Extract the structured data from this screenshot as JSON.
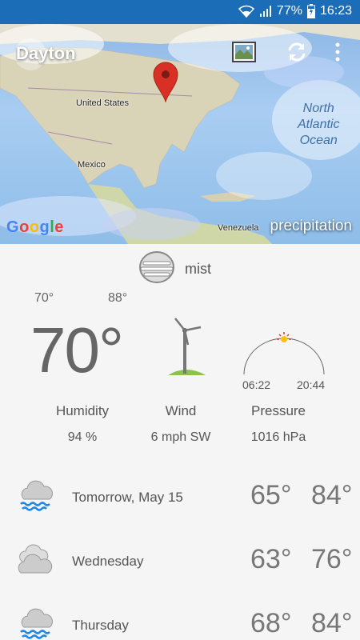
{
  "status_bar": {
    "battery": "77%",
    "time": "16:23",
    "icons": [
      "wifi-icon",
      "signal-icon",
      "battery-charging-icon"
    ]
  },
  "header": {
    "city": "Dayton",
    "map_labels": {
      "us": "United States",
      "mexico": "Mexico",
      "venezuela": "Venezuela",
      "ocean": "North\nAtlantic\nOcean"
    },
    "google_logo": "Google",
    "layer": "precipitation",
    "actions": [
      "map-layer-icon",
      "refresh-icon",
      "more-vert-icon"
    ]
  },
  "current": {
    "condition": "mist",
    "condition_icon": "mist-icon",
    "temp_min": "70°",
    "temp_max": "88°",
    "temp_now": "70°",
    "sunrise": "06:22",
    "sunset": "20:44",
    "stats": [
      {
        "label": "Humidity",
        "value": "94 %"
      },
      {
        "label": "Wind",
        "value": "6 mph SW"
      },
      {
        "label": "Pressure",
        "value": "1016 hPa"
      }
    ]
  },
  "forecast": [
    {
      "day": "Tomorrow, May 15",
      "low": "65°",
      "high": "84°",
      "icon": "rain-cloud-icon"
    },
    {
      "day": "Wednesday",
      "low": "63°",
      "high": "76°",
      "icon": "cloudy-icon"
    },
    {
      "day": "Thursday",
      "low": "68°",
      "high": "84°",
      "icon": "rain-cloud-icon"
    }
  ],
  "colors": {
    "status_bar": "#1b6db7",
    "background": "#f5f5f5",
    "pin": "#d93025",
    "sun": "#e53935"
  }
}
